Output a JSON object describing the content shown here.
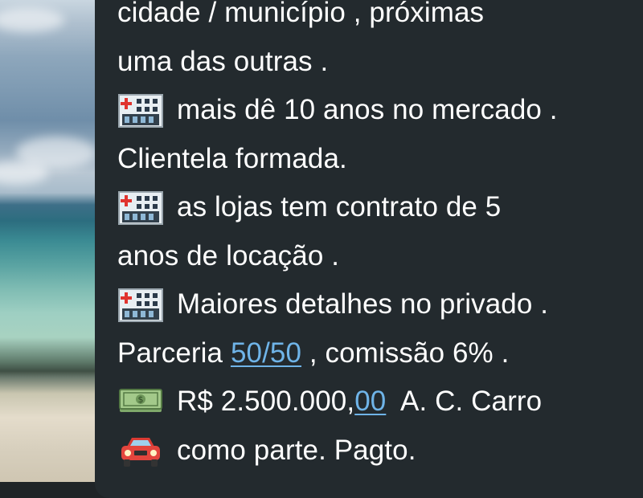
{
  "message": {
    "line1": "cidade / município , próximas",
    "line2": "uma das outras .",
    "line3": "mais dê 10 anos no mercado .",
    "line4": "Clientela formada.",
    "line5": "as lojas tem contrato de 5",
    "line6": "anos de locação .",
    "line7": "Maiores detalhes no privado .",
    "line8_prefix": "Parceria ",
    "line8_link": "50/50",
    "line8_suffix": " , comissão 6% .",
    "line9_prefix": "R$ 2.500.000,",
    "line9_link": "00",
    "line9_suffix": "  A. C. Carro",
    "line10": "como parte. Pagto."
  },
  "icons": {
    "hospital": "hospital-emoji-icon",
    "money": "dollar-banknote-emoji-icon",
    "car": "car-front-emoji-icon"
  },
  "colors": {
    "bubble": "#232a2e",
    "text": "#ffffff",
    "link": "#6fb4e8"
  }
}
